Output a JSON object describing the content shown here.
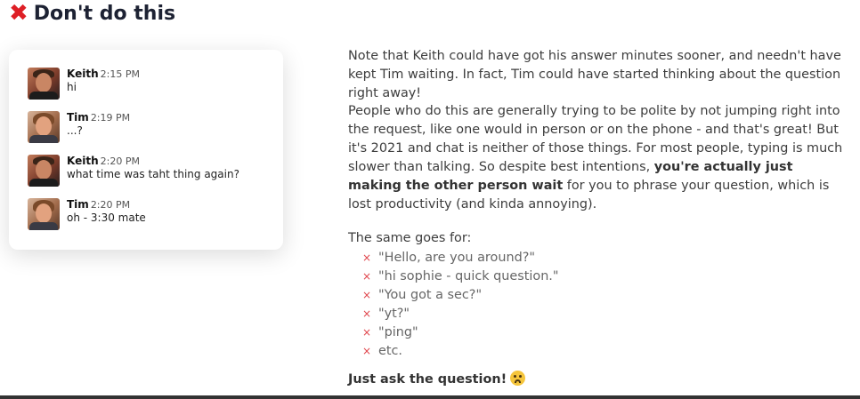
{
  "heading": {
    "icon": "cross-mark-icon",
    "title": "Don't do this"
  },
  "chat": {
    "messages": [
      {
        "author": "Keith",
        "time": "2:15 PM",
        "text": "hi",
        "avatar": "keith-avatar"
      },
      {
        "author": "Tim",
        "time": "2:19 PM",
        "text": "...?",
        "avatar": "tim-avatar"
      },
      {
        "author": "Keith",
        "time": "2:20 PM",
        "text": "what time was taht thing again?",
        "avatar": "keith-avatar"
      },
      {
        "author": "Tim",
        "time": "2:20 PM",
        "text": "oh - 3:30 mate",
        "avatar": "tim-avatar"
      }
    ]
  },
  "article": {
    "para1": "Note that Keith could have got his answer minutes sooner, and needn't have kept Tim waiting. In fact, Tim could have started thinking about the question right away!",
    "para2_start": "People who do this are generally trying to be polite by not jumping right into the request, like one would in person or on the phone - and that's great! But it's 2021 and chat is neither of those things. For most people, typing is much slower than talking. So despite best intentions, ",
    "para2_bold": "you're actually just making the other person wait",
    "para2_end": " for you to phrase your question, which is lost productivity (and kinda annoying).",
    "same_goes": "The same goes for:",
    "bullet_marker": "×",
    "examples": [
      "\"Hello, are you around?\"",
      "\"hi sophie - quick question.\"",
      "\"You got a sec?\"",
      "\"yt?\"",
      "\"ping\"",
      "etc."
    ],
    "closing": "Just ask the question!",
    "closing_emoji": "tired-face-emoji"
  },
  "colors": {
    "heading": "#1d2233",
    "cross": "#de1f26",
    "bullet": "#e0454c",
    "text": "#3d3d3d"
  }
}
